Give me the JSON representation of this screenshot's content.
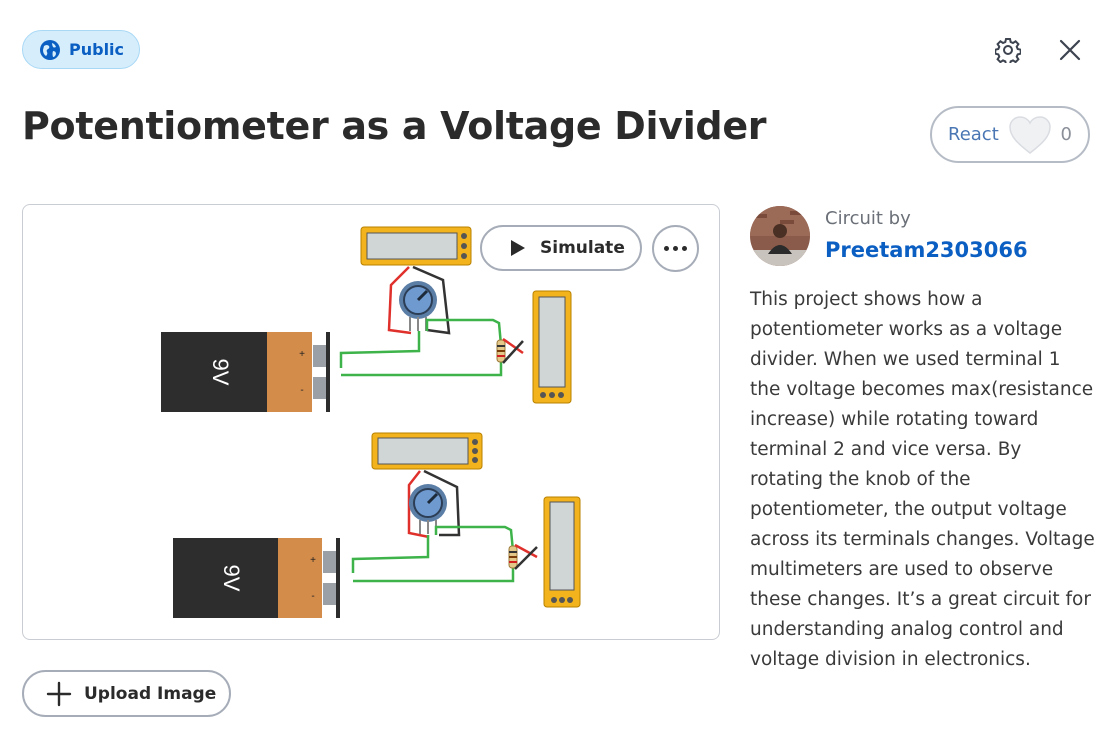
{
  "header": {
    "visibility_badge": "Public",
    "title": "Potentiometer as a Voltage Divider"
  },
  "react": {
    "label": "React",
    "count": "0"
  },
  "canvas": {
    "simulate_label": "Simulate",
    "battery_label": "9V",
    "battery_plus": "+",
    "battery_minus": "-"
  },
  "upload": {
    "label": "Upload Image"
  },
  "author": {
    "by_label": "Circuit by",
    "name": "Preetam2303066"
  },
  "description": "This project shows how a potentiometer works as a voltage divider. When we used terminal 1 the voltage becomes max(resistance increase) while rotating toward terminal 2 and vice versa. By rotating the knob of the potentiometer, the output voltage across its terminals changes. Voltage multimeters are used to observe these changes. It’s a great circuit for understanding analog control and voltage division in electronics.",
  "icons": {
    "badge": "globe-icon",
    "settings": "gear-icon",
    "close": "close-icon",
    "react": "heart-icon",
    "simulate": "play-icon",
    "more": "more-dots-icon",
    "upload": "plus-icon"
  },
  "colors": {
    "accent": "#0b5ec2",
    "badge_bg": "#d6eefc",
    "battery_body": "#2d2d2d",
    "battery_cap": "#d38c4a",
    "multimeter": "#f2b31c",
    "wire_red": "#e0302b",
    "wire_green": "#3db34a",
    "wire_black": "#333333"
  }
}
